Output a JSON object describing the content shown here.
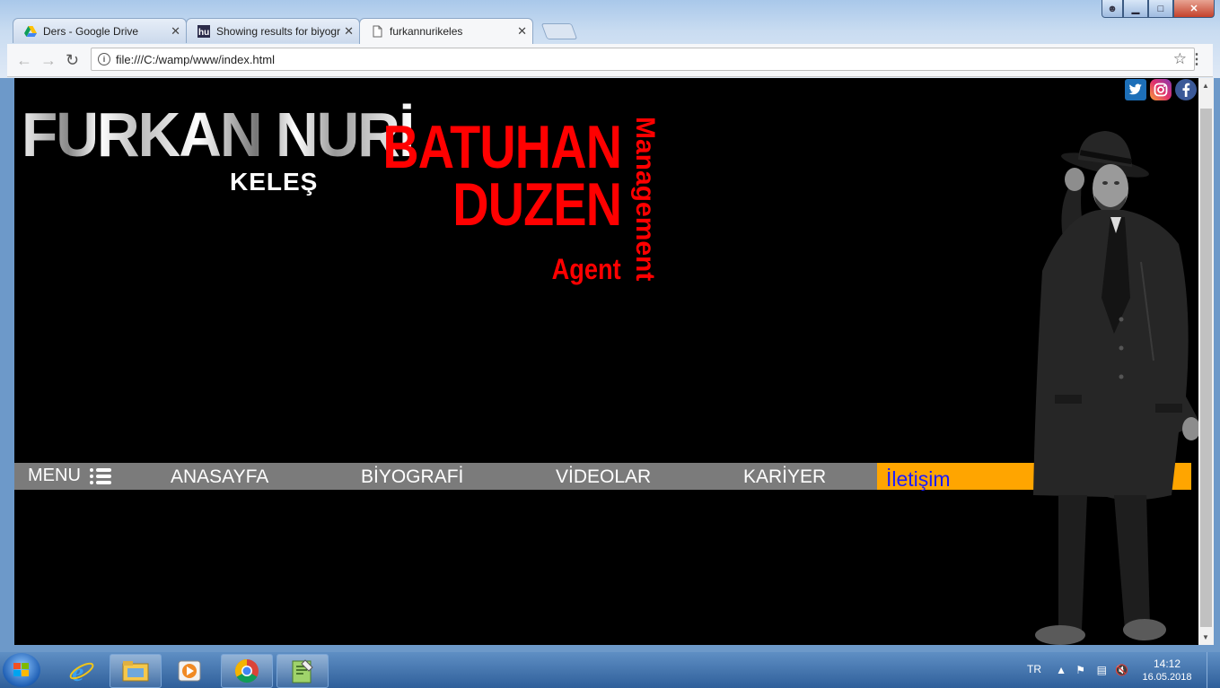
{
  "browser": {
    "tabs": [
      {
        "title": "Ders - Google Drive",
        "favicon": "google-drive-icon"
      },
      {
        "title": "Showing results for biyografi",
        "favicon": "site-icon"
      },
      {
        "title": "furkannurikeles",
        "favicon": "page-icon"
      }
    ],
    "address": "file:///C:/wamp/www/index.html",
    "icons": {
      "back": "back-arrow-icon",
      "forward": "forward-arrow-icon",
      "reload": "reload-icon",
      "bookmark": "star-icon",
      "menu": "kebab-menu-icon"
    }
  },
  "page": {
    "logo_name": "FURKAN NURİ",
    "logo_sub": "KELEŞ",
    "agency": {
      "line1": "BATUHAN",
      "line2": "DUZEN",
      "role": "Agent",
      "vertical": "Management"
    },
    "social": [
      "twitter-icon",
      "instagram-icon",
      "facebook-icon"
    ],
    "nav": {
      "menu_label": "MENU",
      "items": [
        "ANASAYFA",
        "BİYOGRAFİ",
        "VİDEOLAR",
        "KARİYER"
      ],
      "contact": "İletişim"
    },
    "colors": {
      "accent_red": "#ff0000",
      "nav_bg": "#7b7b7b",
      "contact_bg": "#ffa500",
      "contact_text": "#1c1cff"
    }
  },
  "taskbar": {
    "language": "TR",
    "time": "14:12",
    "date": "16.05.2018"
  }
}
